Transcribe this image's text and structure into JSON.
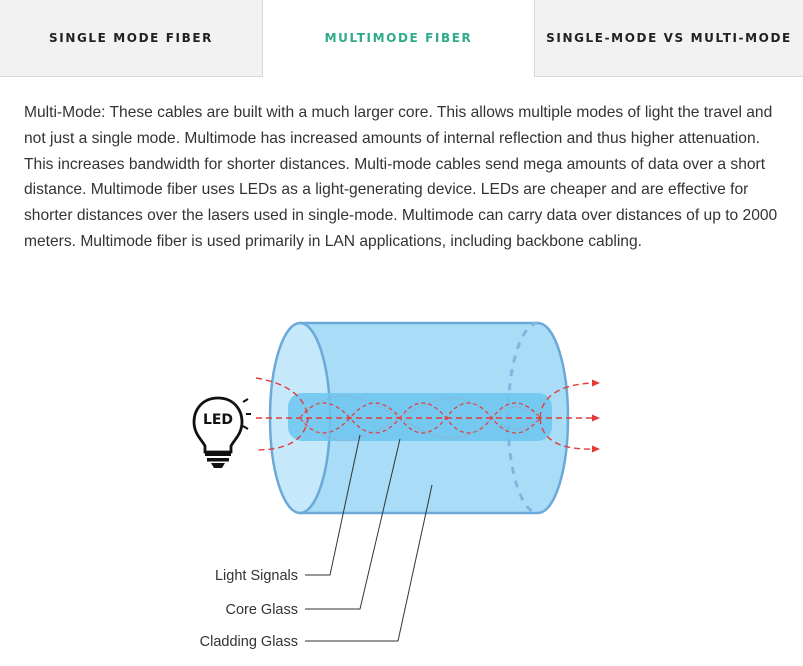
{
  "tabs": [
    {
      "label": "SINGLE MODE FIBER",
      "active": false
    },
    {
      "label": "MULTIMODE FIBER",
      "active": true
    },
    {
      "label": "SINGLE-MODE VS MULTI-MODE",
      "active": false
    }
  ],
  "accent_color": "#2fab8a",
  "content": {
    "paragraph": "Multi-Mode: These cables are built with a much larger core. This allows multiple modes of light the travel and not just a single mode. Multimode has increased amounts of internal reflection and thus higher attenuation. This increases bandwidth for shorter distances. Multi-mode cables send mega amounts of data over a short distance. Multimode fiber uses LEDs as a light-generating device. LEDs are cheaper and are effective for shorter distances over the lasers used in single-mode. Multimode can carry data over distances of up to 2000 meters. Multimode fiber is used primarily in LAN applications, including backbone cabling."
  },
  "diagram": {
    "led_label": "LED",
    "labels": {
      "light_signals": "Light Signals",
      "core_glass": "Core Glass",
      "cladding_glass": "Cladding Glass"
    },
    "colors": {
      "cladding": "#a9ddf7",
      "cladding_stroke": "#6aa9d8",
      "core": "#6cc6f0",
      "signal": "#e53a3a"
    }
  }
}
